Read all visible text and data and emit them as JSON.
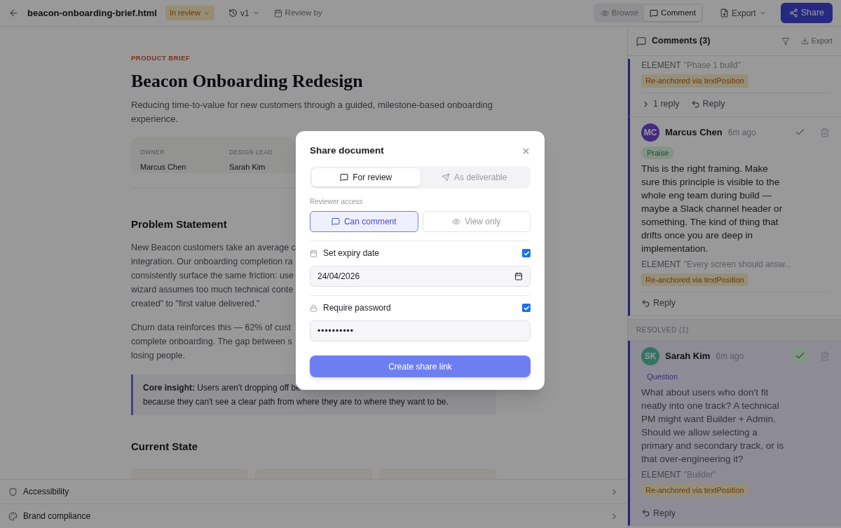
{
  "topbar": {
    "filename": "beacon-onboarding-brief.html",
    "status": "In review",
    "version": "v1",
    "review_by": "Review by",
    "modes": [
      {
        "label": "Browse",
        "selected": false
      },
      {
        "label": "Comment",
        "selected": true
      }
    ],
    "export": "Export",
    "share": "Share"
  },
  "document": {
    "eyebrow": "PRODUCT BRIEF",
    "title": "Beacon Onboarding Redesign",
    "subtitle": "Reducing time-to-value for new customers through a guided, milestone-based onboarding\nexperience.",
    "meta": [
      {
        "label": "OWNER",
        "value": "Marcus Chen"
      },
      {
        "label": "DESIGN LEAD",
        "value": "Sarah Kim"
      }
    ],
    "problem_heading": "Problem Statement",
    "paragraphs": [
      "New Beacon customers take an average c\nintegration. Our onboarding completion ra\nconsistently surface the same friction: use\nwizard assumes too much technical conte\ncreated\" to \"first value delivered.\"",
      "Churn data reinforces this — 62% of cust\ncomplete onboarding. The gap between s\nlosing people."
    ],
    "callout": "**Core insight:** Users aren't dropping off be\nbecause they can't see a clear path from where they are to where they want to be.",
    "current_heading": "Current State"
  },
  "bottom_panels": [
    {
      "label": "Accessibility",
      "expanded": false
    },
    {
      "label": "Brand compliance",
      "expanded": false
    }
  ],
  "comments": {
    "title": "Comments (3)",
    "export": "Export",
    "open_threads": [
      {
        "element_label": "ELEMENT",
        "element_text": "\"Phase 1 build\"",
        "anchor_badge": "Re-anchored via textPosition",
        "replies": "1 reply",
        "reply": "Reply"
      },
      {
        "initials": "MC",
        "author": "Marcus Chen",
        "time": "6m ago",
        "tag": {
          "label": "Praise",
          "kind": "praise"
        },
        "body": "This is the right framing. Make sure this principle is visible to the whole eng team during build — maybe a Slack channel header or something. The kind of thing that drifts once you are deep in implementation.",
        "element_label": "ELEMENT",
        "element_text": "\"Every screen should answ...",
        "anchor_badge": "Re-anchored via textPosition",
        "reply": "Reply",
        "resolved": false
      }
    ],
    "resolved_header": "RESOLVED (1)",
    "resolved_threads": [
      {
        "initials": "SK",
        "author": "Sarah Kim",
        "time": "6m ago",
        "tag": {
          "label": "Question",
          "kind": "question"
        },
        "body": "What about users who don't fit neatly into one track? A technical PM might want Builder + Admin. Should we allow selecting a primary and secondary track, or is that over-engineering it?",
        "element_label": "ELEMENT",
        "element_text": "\"Builder\"",
        "anchor_badge": "Re-anchored via textPosition",
        "reply": "Reply",
        "resolved": true
      }
    ]
  },
  "dialog": {
    "title": "Share document",
    "modes": [
      {
        "label": "For review",
        "selected": true
      },
      {
        "label": "As deliverable",
        "selected": false
      }
    ],
    "access_label": "Reviewer access",
    "access": [
      {
        "label": "Can comment",
        "selected": true
      },
      {
        "label": "View only",
        "selected": false
      }
    ],
    "expiry": {
      "label": "Set expiry date",
      "checked": true,
      "value": "24/04/2026"
    },
    "password": {
      "label": "Require password",
      "checked": true,
      "value": "••••••••••"
    },
    "submit": "Create share link"
  }
}
